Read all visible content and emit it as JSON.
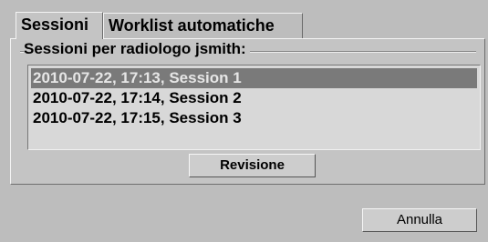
{
  "tabs": [
    {
      "label": "Sessioni"
    },
    {
      "label": "Worklist automatiche"
    }
  ],
  "group": {
    "title": "Sessioni per radiologo jsmith:"
  },
  "sessions": [
    {
      "label": "2010-07-22, 17:13, Session 1",
      "selected": true
    },
    {
      "label": "2010-07-22, 17:14, Session 2",
      "selected": false
    },
    {
      "label": "2010-07-22, 17:15, Session 3",
      "selected": false
    }
  ],
  "buttons": {
    "review": "Revisione",
    "cancel": "Annulla"
  }
}
